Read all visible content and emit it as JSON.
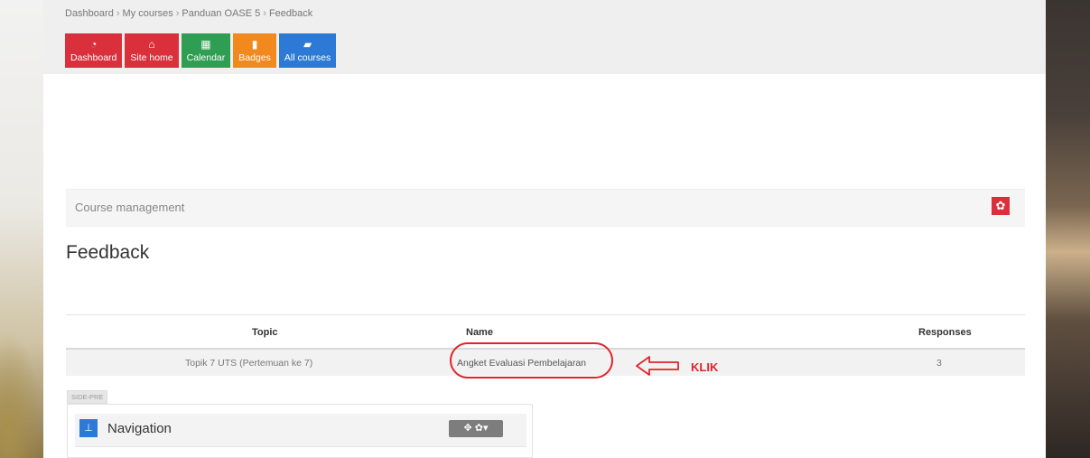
{
  "breadcrumb": [
    "Dashboard",
    "My courses",
    "Panduan OASE 5",
    "Feedback"
  ],
  "nav_buttons": [
    {
      "label": "Dashboard",
      "icon": "dashboard-icon",
      "color": "#d9303c"
    },
    {
      "label": "Site home",
      "icon": "home-icon",
      "color": "#d9303c"
    },
    {
      "label": "Calendar",
      "icon": "calendar-icon",
      "color": "#2f9e53"
    },
    {
      "label": "Badges",
      "icon": "bookmark-icon",
      "color": "#f2891e"
    },
    {
      "label": "All courses",
      "icon": "book-icon",
      "color": "#2c7ad6"
    }
  ],
  "course_management": {
    "label": "Course management"
  },
  "page_title": "Feedback",
  "table": {
    "headers": {
      "topic": "Topic",
      "name": "Name",
      "responses": "Responses"
    },
    "rows": [
      {
        "topic": "Topik 7 UTS (Pertemuan ke 7)",
        "name": "Angket Evaluasi Pembelajaran",
        "responses": "3"
      }
    ]
  },
  "annotation": {
    "text": "KLIK",
    "color": "#e0242c"
  },
  "side_pre_label": "SIDE-PRE",
  "navigation_block": {
    "title": "Navigation"
  }
}
